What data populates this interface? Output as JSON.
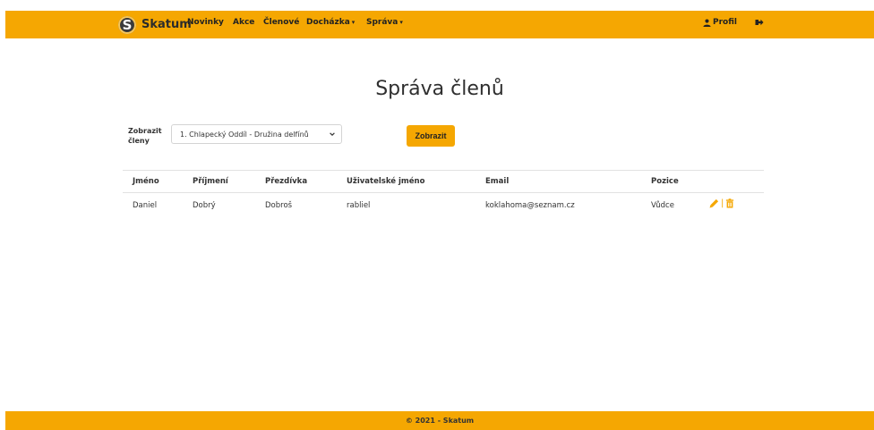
{
  "navbar": {
    "brand_letter": "S",
    "brand_name": "Skatum",
    "items": [
      "Novinky",
      "Akce",
      "Členové",
      "Docházka",
      "Správa"
    ],
    "profile_label": "Profil"
  },
  "page": {
    "title": "Správa členů"
  },
  "filter": {
    "label": "Zobrazit členy",
    "selected": "1. Chlapecký Oddíl - Družina delfínů",
    "button_label": "Zobrazit"
  },
  "table": {
    "headers": [
      "Jméno",
      "Příjmení",
      "Přezdívka",
      "Uživatelské jméno",
      "Email",
      "Pozice"
    ],
    "rows": [
      [
        "Daniel",
        "Dobrý",
        "Dobroš",
        "rabliel",
        "koklahoma@seznam.cz",
        "Vůdce"
      ]
    ]
  },
  "footer": {
    "text": "© 2021 - Skatum"
  },
  "colors": {
    "accent": "#f5a702"
  }
}
